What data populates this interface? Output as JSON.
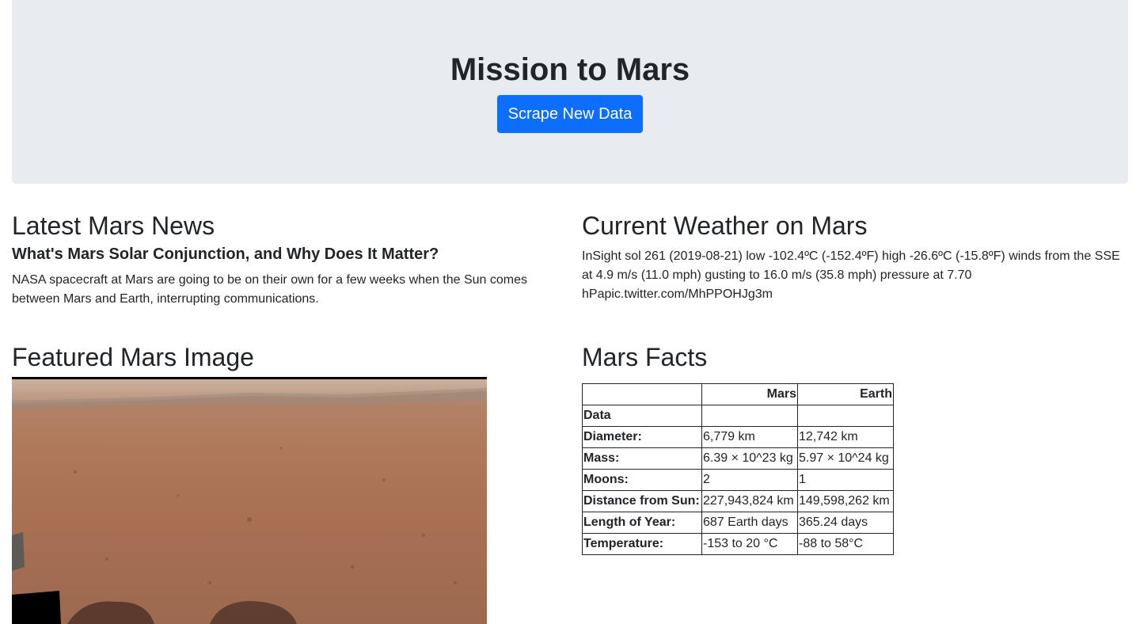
{
  "header": {
    "title": "Mission to Mars",
    "scrape_button": "Scrape New Data"
  },
  "news": {
    "heading": "Latest Mars News",
    "title": "What's Mars Solar Conjunction, and Why Does It Matter?",
    "paragraph": "NASA spacecraft at Mars are going to be on their own for a few weeks when the Sun comes between Mars and Earth, interrupting communications."
  },
  "weather": {
    "heading": "Current Weather on Mars",
    "text": "InSight sol 261 (2019-08-21) low -102.4ºC (-152.4ºF) high -26.6ºC (-15.8ºF) winds from the SSE at 4.9 m/s (11.0 mph) gusting to 16.0 m/s (35.8 mph) pressure at 7.70 hPapic.twitter.com/MhPPOHJg3m"
  },
  "featured": {
    "heading": "Featured Mars Image"
  },
  "facts": {
    "heading": "Mars Facts",
    "columns": [
      "",
      "Mars",
      "Earth"
    ],
    "index_label": "Data",
    "rows": [
      {
        "label": "Diameter:",
        "mars": "6,779 km",
        "earth": "12,742 km"
      },
      {
        "label": "Mass:",
        "mars": "6.39 × 10^23 kg",
        "earth": "5.97 × 10^24 kg"
      },
      {
        "label": "Moons:",
        "mars": "2",
        "earth": "1"
      },
      {
        "label": "Distance from Sun:",
        "mars": "227,943,824 km",
        "earth": "149,598,262 km"
      },
      {
        "label": "Length of Year:",
        "mars": "687 Earth days",
        "earth": "365.24 days"
      },
      {
        "label": "Temperature:",
        "mars": "-153 to 20 °C",
        "earth": "-88 to 58°C"
      }
    ]
  },
  "colors": {
    "jumbotron_bg": "#e9ecef",
    "button_primary": "#0d6efd",
    "text": "#212529"
  }
}
